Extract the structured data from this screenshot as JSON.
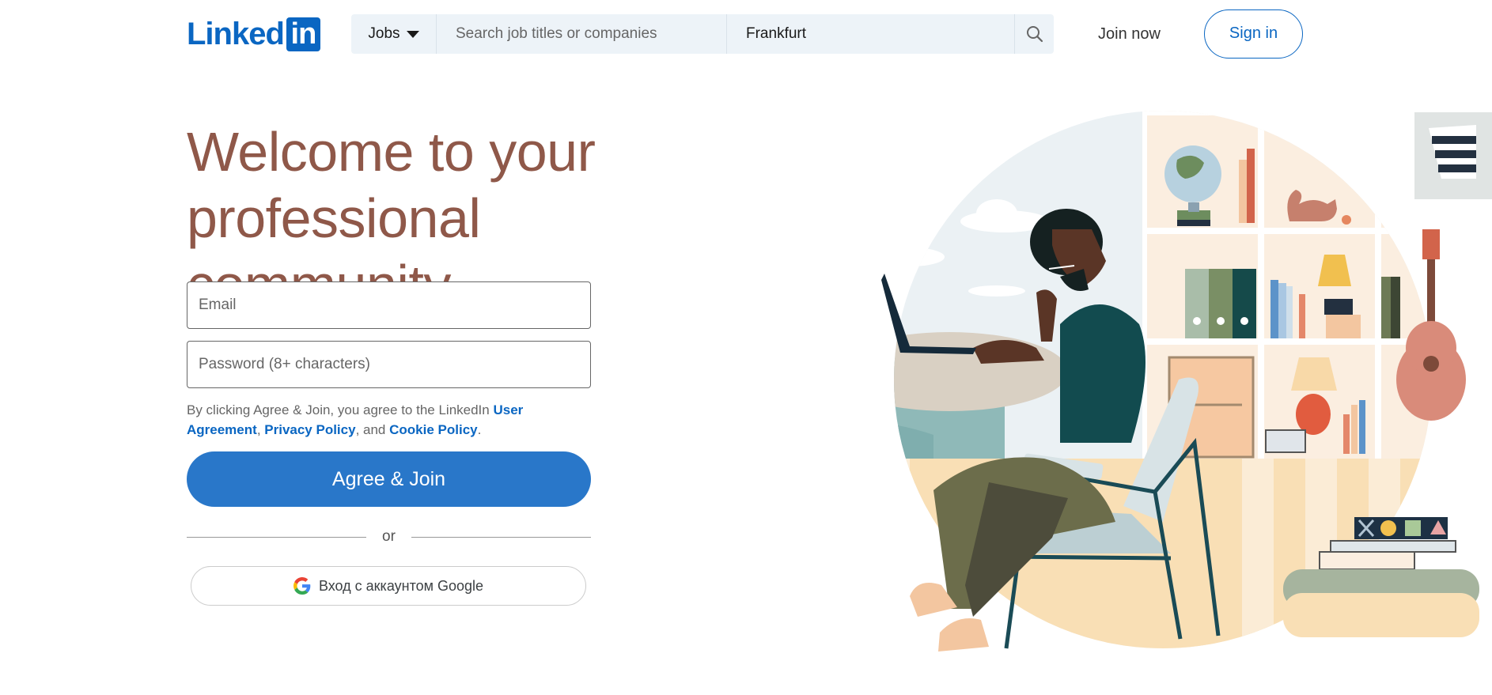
{
  "header": {
    "logo_text": "Linked",
    "logo_box": "in",
    "search_category": "Jobs",
    "keyword_placeholder": "Search job titles or companies",
    "location_value": "Frankfurt",
    "join_now": "Join now",
    "sign_in": "Sign in"
  },
  "hero": {
    "title_line1": "Welcome to your",
    "title_line2": "professional community"
  },
  "form": {
    "email_placeholder": "Email",
    "password_placeholder": "Password (8+ characters)",
    "legal_prefix": "By clicking Agree & Join, you agree to the LinkedIn ",
    "user_agreement": "User Agreement",
    "comma": ", ",
    "privacy_policy": "Privacy Policy",
    "and_text": ", and ",
    "cookie_policy": "Cookie Policy",
    "period": ".",
    "agree_button": "Agree & Join",
    "or": "or",
    "google_button": "Вход с аккаунтом Google"
  },
  "colors": {
    "brand": "#0a66c2",
    "agree_button": "#2977c9",
    "hero_title": "#8f5849"
  },
  "icons": [
    "search-icon",
    "chevron-down-icon",
    "google-icon"
  ]
}
